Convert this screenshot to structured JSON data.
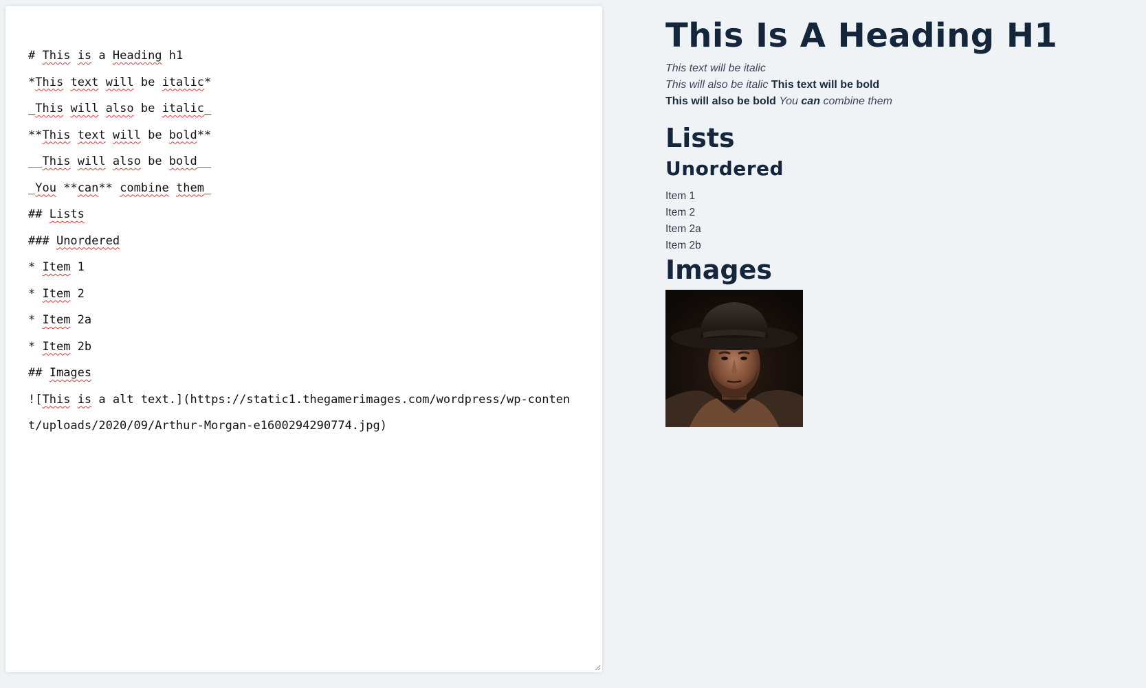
{
  "editor": {
    "lines": [
      [
        {
          "t": "# "
        },
        {
          "t": "This",
          "s": true
        },
        {
          "t": " "
        },
        {
          "t": "is",
          "s": true
        },
        {
          "t": " a "
        },
        {
          "t": "Heading",
          "s": true
        },
        {
          "t": " h1"
        }
      ],
      [
        {
          "t": "*"
        },
        {
          "t": "This",
          "s": true
        },
        {
          "t": " "
        },
        {
          "t": "text",
          "s": true
        },
        {
          "t": " "
        },
        {
          "t": "will",
          "s": true
        },
        {
          "t": " be "
        },
        {
          "t": "italic",
          "s": true
        },
        {
          "t": "*"
        }
      ],
      [
        {
          "t": "_"
        },
        {
          "t": "This",
          "s": true
        },
        {
          "t": " "
        },
        {
          "t": "will",
          "s": true
        },
        {
          "t": " "
        },
        {
          "t": "also",
          "s": true
        },
        {
          "t": " be "
        },
        {
          "t": "italic",
          "s": true
        },
        {
          "t": "_"
        }
      ],
      [
        {
          "t": "**"
        },
        {
          "t": "This",
          "s": true
        },
        {
          "t": " "
        },
        {
          "t": "text",
          "s": true
        },
        {
          "t": " "
        },
        {
          "t": "will",
          "s": true
        },
        {
          "t": " be "
        },
        {
          "t": "bold",
          "s": true
        },
        {
          "t": "**"
        }
      ],
      [
        {
          "t": "__"
        },
        {
          "t": "This",
          "s": true
        },
        {
          "t": " "
        },
        {
          "t": "will",
          "s": true
        },
        {
          "t": " "
        },
        {
          "t": "also",
          "s": true
        },
        {
          "t": " be "
        },
        {
          "t": "bold",
          "s": true
        },
        {
          "t": "__"
        }
      ],
      [
        {
          "t": "_"
        },
        {
          "t": "You",
          "s": true
        },
        {
          "t": " **"
        },
        {
          "t": "can",
          "s": true
        },
        {
          "t": "** "
        },
        {
          "t": "combine",
          "s": true
        },
        {
          "t": " "
        },
        {
          "t": "them",
          "s": true
        },
        {
          "t": "_"
        }
      ],
      [
        {
          "t": "## "
        },
        {
          "t": "Lists",
          "s": true
        }
      ],
      [
        {
          "t": "### "
        },
        {
          "t": "Unordered",
          "s": true
        }
      ],
      [
        {
          "t": "* "
        },
        {
          "t": "Item",
          "s": true
        },
        {
          "t": " 1"
        }
      ],
      [
        {
          "t": "* "
        },
        {
          "t": "Item",
          "s": true
        },
        {
          "t": " 2"
        }
      ],
      [
        {
          "t": "* "
        },
        {
          "t": "Item",
          "s": true
        },
        {
          "t": " 2a"
        }
      ],
      [
        {
          "t": "* "
        },
        {
          "t": "Item",
          "s": true
        },
        {
          "t": " 2b"
        }
      ],
      [
        {
          "t": "## "
        },
        {
          "t": "Images",
          "s": true
        }
      ],
      [
        {
          "t": "!["
        },
        {
          "t": "This",
          "s": true
        },
        {
          "t": " "
        },
        {
          "t": "is",
          "s": true
        },
        {
          "t": " a alt text.](https://static1.thegamerimages.com/wordpress/wp-content/uploads/2020/09/Arthur-Morgan-e1600294290774.jpg)"
        }
      ]
    ]
  },
  "preview": {
    "h1": "This Is A Heading H1",
    "italic1": "This text will be italic",
    "italic2": "This will also be italic",
    "bold1": "This text will be bold",
    "bold2": "This will also be bold",
    "combine_you": "You",
    "combine_can": "can",
    "combine_rest": "combine them",
    "lists_heading": "Lists",
    "unordered_heading": "Unordered",
    "items": [
      "Item 1",
      "Item 2",
      "Item 2a",
      "Item 2b"
    ],
    "images_heading": "Images",
    "image_alt": "This is a alt text."
  },
  "colors": {
    "background": "#f0f3f6",
    "heading": "#14263b",
    "spellcheck": "#e0342f"
  }
}
